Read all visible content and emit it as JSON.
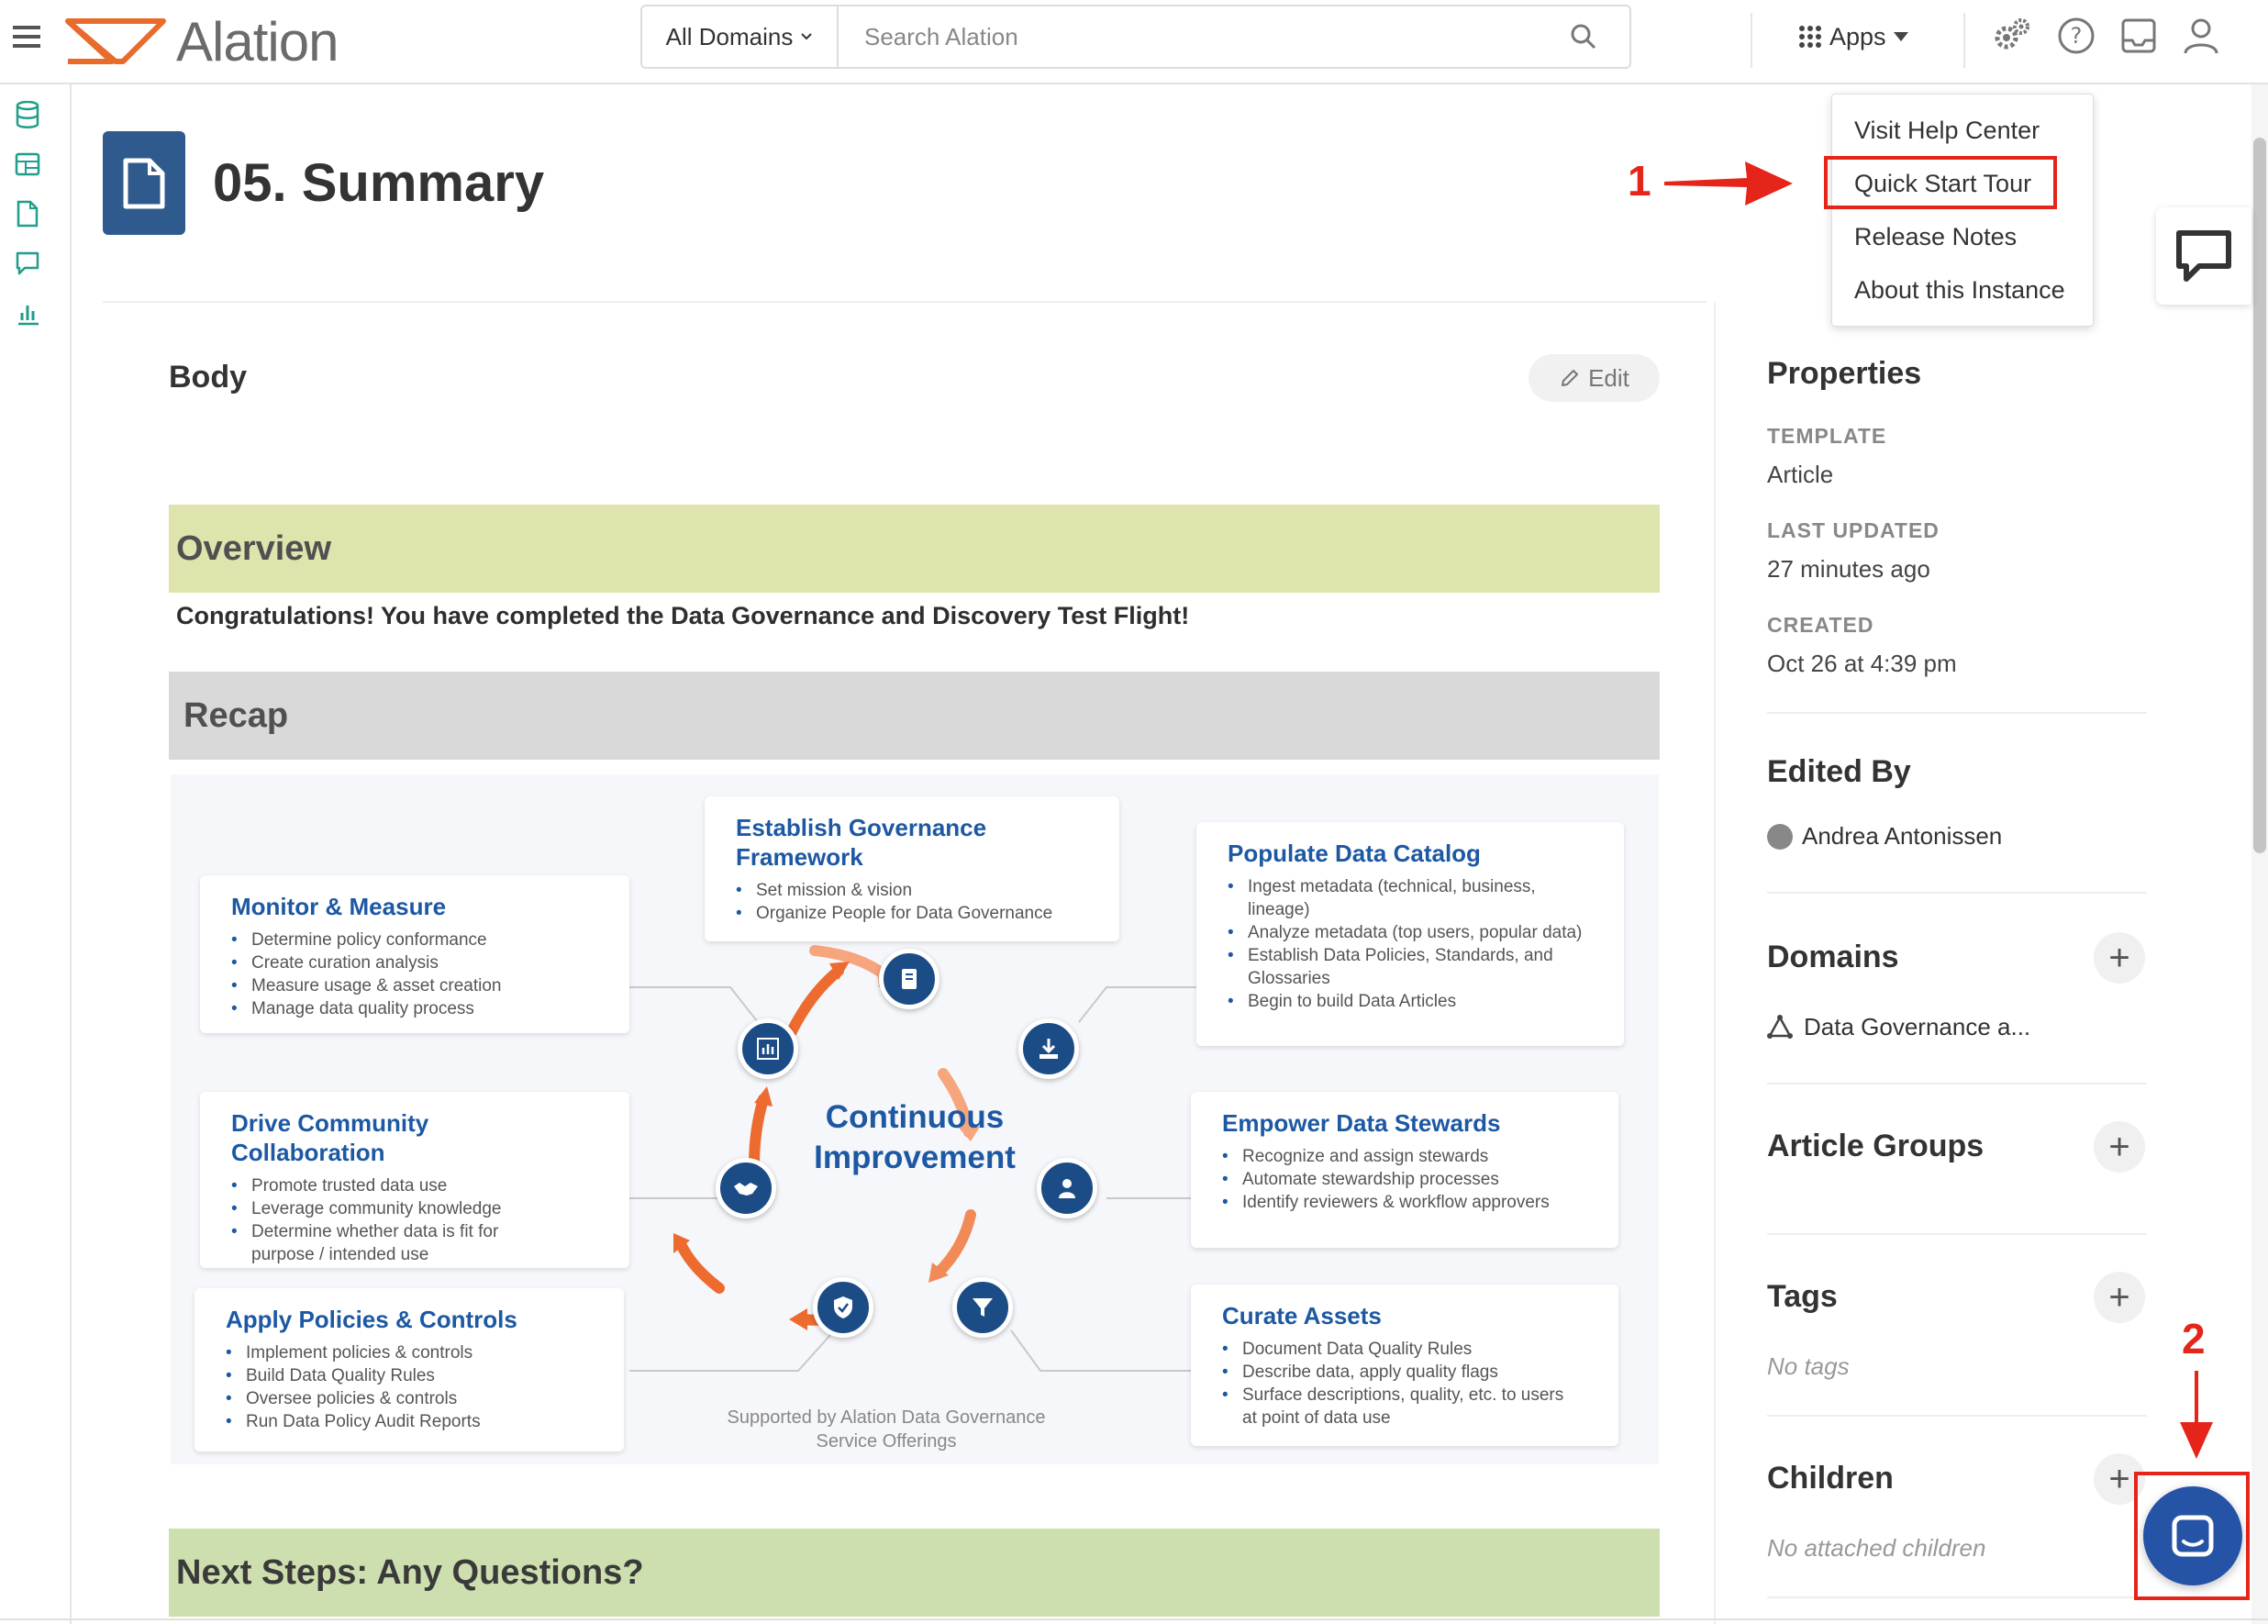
{
  "header": {
    "logo_text": "Alation",
    "domain_select": "All Domains",
    "search_placeholder": "Search Alation",
    "apps_label": "Apps"
  },
  "page": {
    "title": "05. Summary",
    "body_label": "Body",
    "edit_label": "Edit"
  },
  "content": {
    "overview_heading": "Overview",
    "congrats_text": "Congratulations! You have completed the Data Governance and Discovery Test Flight!",
    "recap_heading": "Recap",
    "next_steps_heading": "Next Steps: Any Questions?"
  },
  "diagram": {
    "center_line1": "Continuous",
    "center_line2": "Improvement",
    "supported_line1": "Supported by Alation Data Governance",
    "supported_line2": "Service Offerings",
    "cards": [
      {
        "title": "Establish Governance Framework",
        "items": [
          "Set mission & vision",
          "Organize People for Data Governance"
        ]
      },
      {
        "title": "Populate Data Catalog",
        "items": [
          "Ingest metadata (technical, business, lineage)",
          "Analyze metadata (top users, popular data)",
          "Establish Data Policies, Standards, and Glossaries",
          "Begin to build Data Articles"
        ]
      },
      {
        "title": "Monitor & Measure",
        "items": [
          "Determine policy conformance",
          "Create curation analysis",
          "Measure usage & asset creation",
          "Manage data quality process"
        ]
      },
      {
        "title": "Empower Data Stewards",
        "items": [
          "Recognize and assign stewards",
          "Automate stewardship processes",
          "Identify reviewers & workflow approvers"
        ]
      },
      {
        "title": "Drive Community Collaboration",
        "items": [
          "Promote trusted data use",
          "Leverage community knowledge",
          "Determine whether data is fit for purpose / intended use"
        ]
      },
      {
        "title": "Apply Policies & Controls",
        "items": [
          "Implement policies & controls",
          "Build Data Quality Rules",
          "Oversee policies & controls",
          "Run Data Policy Audit Reports"
        ]
      },
      {
        "title": "Curate Assets",
        "items": [
          "Document Data Quality Rules",
          "Describe data, apply quality flags",
          "Surface descriptions, quality, etc. to users at point of data use"
        ]
      }
    ]
  },
  "sidebar": {
    "properties_title": "Properties",
    "template_label": "TEMPLATE",
    "template_value": "Article",
    "last_updated_label": "LAST UPDATED",
    "last_updated_value": "27 minutes ago",
    "created_label": "CREATED",
    "created_value": "Oct 26 at 4:39 pm",
    "edited_by_title": "Edited By",
    "editor_name": "Andrea Antonissen",
    "domains_title": "Domains",
    "domain_value": "Data Governance a...",
    "article_groups_title": "Article Groups",
    "tags_title": "Tags",
    "tags_empty": "No tags",
    "children_title": "Children",
    "children_empty": "No attached children"
  },
  "help_menu": {
    "items": [
      "Visit Help Center",
      "Quick Start Tour",
      "Release Notes",
      "About this Instance"
    ]
  },
  "annotations": {
    "step1": "1",
    "step2": "2"
  },
  "colors": {
    "brand_orange": "#e86b2c",
    "brand_blue": "#1d58a3",
    "annotation_red": "#e5251a",
    "overview_bg": "#dfe4ad",
    "next_steps_bg": "#cddfae"
  }
}
